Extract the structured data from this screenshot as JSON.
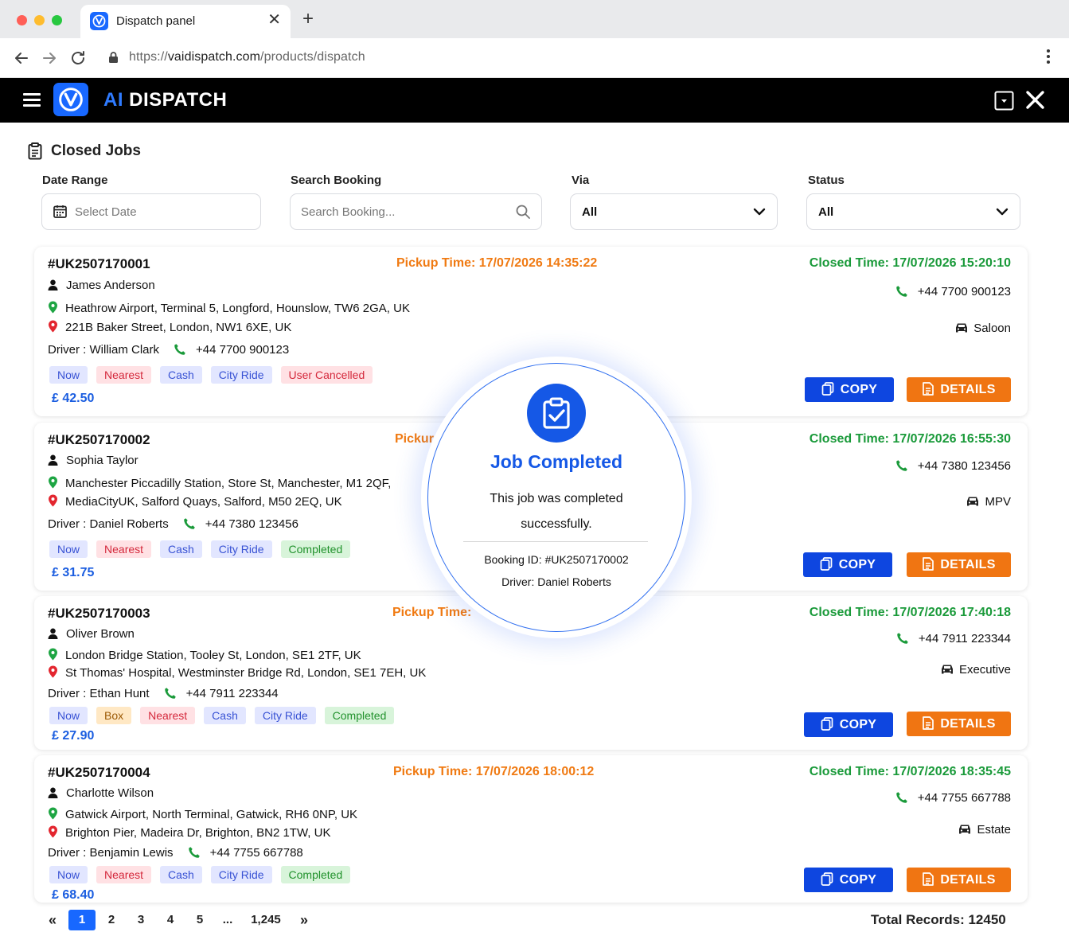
{
  "browser": {
    "tab_title": "Dispatch panel",
    "url_prefix": "https://",
    "url_host": "vaidispatch.com",
    "url_path": "/products/dispatch"
  },
  "app": {
    "brand_ai": "AI",
    "brand_name": "DISPATCH"
  },
  "page": {
    "title": "Closed Jobs"
  },
  "filters": {
    "date_range_label": "Date Range",
    "date_placeholder": "Select Date",
    "search_label": "Search Booking",
    "search_placeholder": "Search Booking...",
    "via_label": "Via",
    "via_value": "All",
    "status_label": "Status",
    "status_value": "All"
  },
  "labels": {
    "pickup_prefix": "Pickup Time: ",
    "closed_prefix": "Closed Time: ",
    "driver_prefix": "Driver : ",
    "copy": "COPY",
    "details": "DETAILS"
  },
  "jobs": [
    {
      "id": "#UK2507170001",
      "pickup_time": "17/07/2026 14:35:22",
      "closed_time": "17/07/2026 15:20:10",
      "customer": "James Anderson",
      "pickup_address": "Heathrow Airport, Terminal 5, Longford, Hounslow, TW6 2GA, UK",
      "dropoff_address": "221B Baker Street, London, NW1 6XE, UK",
      "driver": "William Clark",
      "driver_phone": "+44 7700 900123",
      "customer_phone": "+44 7700 900123",
      "vehicle": "Saloon",
      "tags": [
        {
          "label": "Now",
          "kind": "now"
        },
        {
          "label": "Nearest",
          "kind": "nearest"
        },
        {
          "label": "Cash",
          "kind": "cash"
        },
        {
          "label": "City Ride",
          "kind": "city"
        },
        {
          "label": "User Cancelled",
          "kind": "cancel"
        }
      ],
      "price": "£ 42.50"
    },
    {
      "id": "#UK2507170002",
      "pickup_time": "",
      "pickup_visible": "Pickur",
      "closed_time": "17/07/2026 16:55:30",
      "customer": "Sophia Taylor",
      "pickup_address": "Manchester Piccadilly Station, Store St, Manchester, M1 2QF,",
      "dropoff_address": "MediaCityUK, Salford Quays, Salford, M50 2EQ, UK",
      "driver": "Daniel Roberts",
      "driver_phone": "+44 7380 123456",
      "customer_phone": "+44 7380 123456",
      "vehicle": "MPV",
      "tags": [
        {
          "label": "Now",
          "kind": "now"
        },
        {
          "label": "Nearest",
          "kind": "nearest"
        },
        {
          "label": "Cash",
          "kind": "cash"
        },
        {
          "label": "City Ride",
          "kind": "city"
        },
        {
          "label": "Completed",
          "kind": "completed"
        }
      ],
      "price": "£ 31.75"
    },
    {
      "id": "#UK2507170003",
      "pickup_time": "",
      "pickup_visible": "Pickup Time:",
      "closed_time": "17/07/2026 17:40:18",
      "customer": "Oliver Brown",
      "pickup_address": "London Bridge Station, Tooley St, London, SE1 2TF, UK",
      "dropoff_address": "St Thomas' Hospital, Westminster Bridge Rd, London, SE1 7EH, UK",
      "driver": "Ethan Hunt",
      "driver_phone": "+44 7911 223344",
      "customer_phone": "+44 7911 223344",
      "vehicle": "Executive",
      "tags": [
        {
          "label": "Now",
          "kind": "now"
        },
        {
          "label": "Box",
          "kind": "box"
        },
        {
          "label": "Nearest",
          "kind": "nearest"
        },
        {
          "label": "Cash",
          "kind": "cash"
        },
        {
          "label": "City Ride",
          "kind": "city"
        },
        {
          "label": "Completed",
          "kind": "completed"
        }
      ],
      "price": "£ 27.90"
    },
    {
      "id": "#UK2507170004",
      "pickup_time": "17/07/2026 18:00:12",
      "closed_time": "17/07/2026 18:35:45",
      "customer": "Charlotte Wilson",
      "pickup_address": "Gatwick Airport, North Terminal, Gatwick, RH6 0NP, UK",
      "dropoff_address": "Brighton Pier, Madeira Dr, Brighton, BN2 1TW, UK",
      "driver": "Benjamin Lewis",
      "driver_phone": "+44 7755 667788",
      "customer_phone": "+44 7755 667788",
      "vehicle": "Estate",
      "tags": [
        {
          "label": "Now",
          "kind": "now"
        },
        {
          "label": "Nearest",
          "kind": "nearest"
        },
        {
          "label": "Cash",
          "kind": "cash"
        },
        {
          "label": "City Ride",
          "kind": "city"
        },
        {
          "label": "Completed",
          "kind": "completed"
        }
      ],
      "price": "£ 68.40"
    }
  ],
  "pagination": {
    "first": "«",
    "pages": [
      "1",
      "2",
      "3",
      "4",
      "5",
      "...",
      "1,245"
    ],
    "active_page": "1",
    "last": "»",
    "total_records": "Total Records: 12450"
  },
  "popup": {
    "title": "Job Completed",
    "message": "This job was completed successfully.",
    "booking_line": "Booking ID: #UK2507170002",
    "driver_line": "Driver: Daniel Roberts"
  },
  "colors": {
    "brand_blue": "#1868ff",
    "pickup_orange": "#f07a12",
    "closed_green": "#1a9a3a",
    "copy_blue": "#0e46e0",
    "details_orange": "#f07512"
  }
}
